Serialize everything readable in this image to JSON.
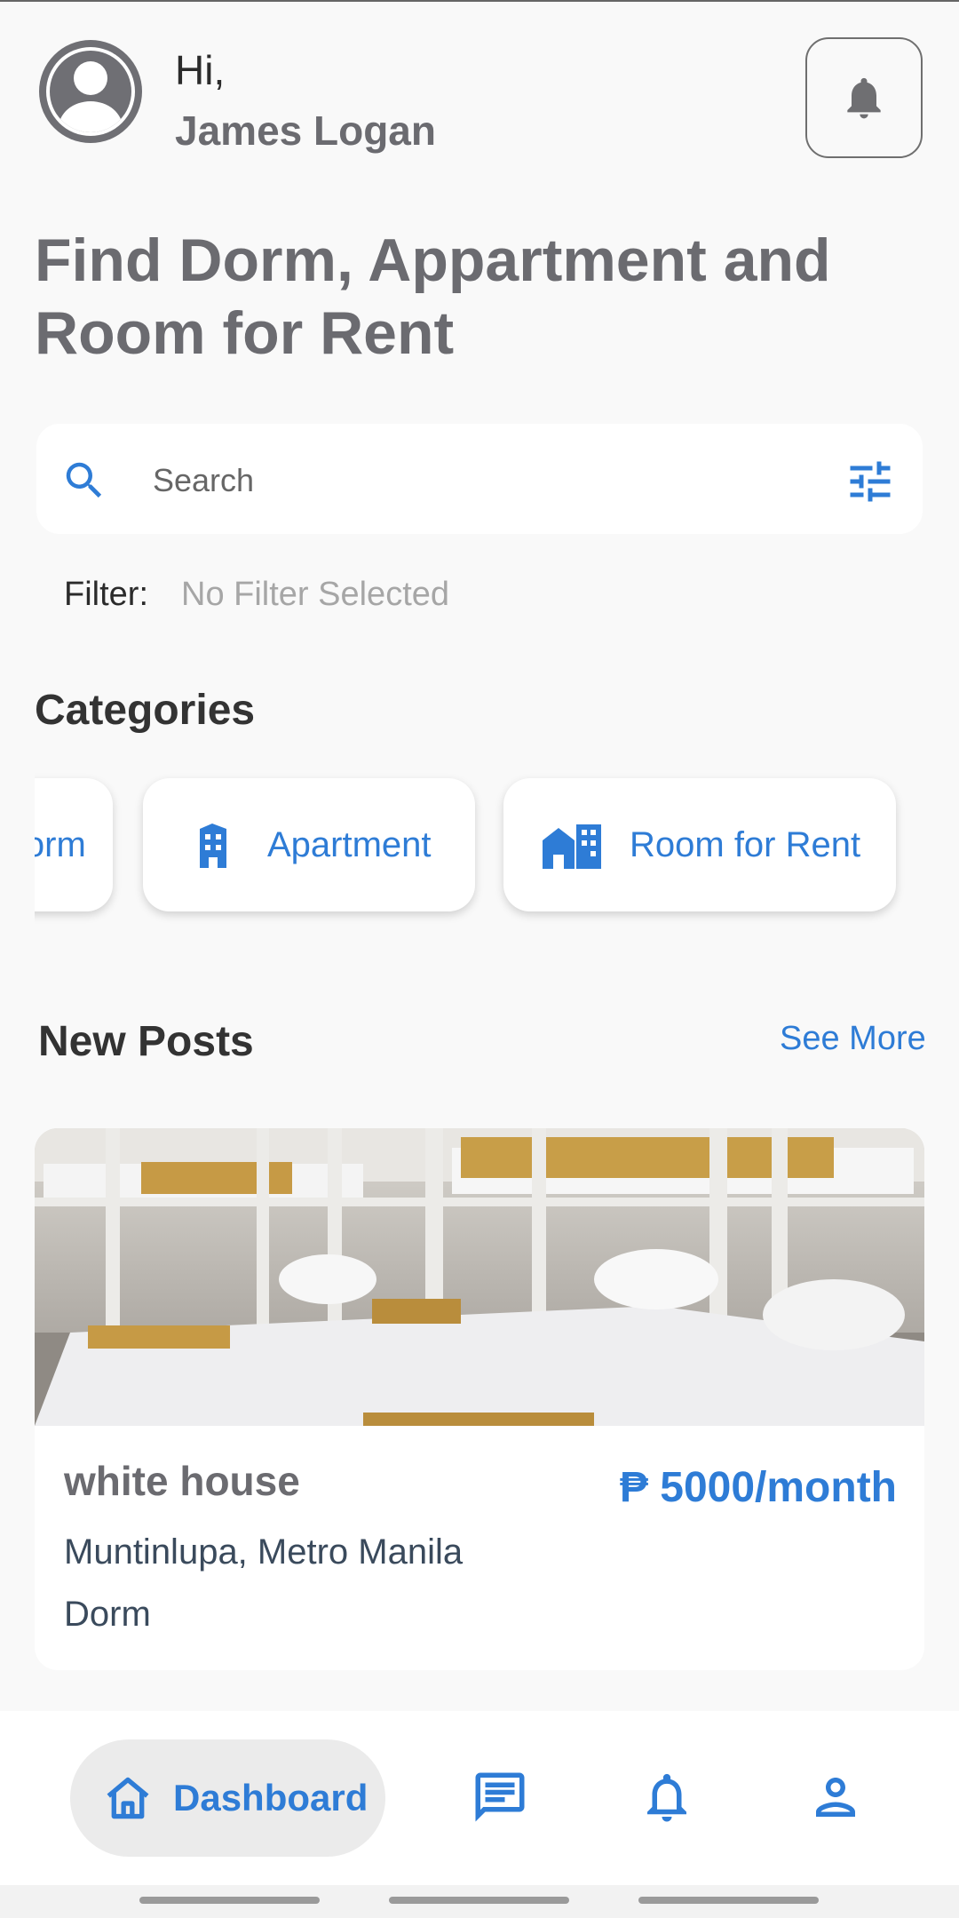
{
  "header": {
    "greeting": "Hi,",
    "user_name": "James Logan",
    "headline": "Find Dorm, Appartment and Room for Rent"
  },
  "search": {
    "placeholder": "Search",
    "value": ""
  },
  "filter": {
    "label": "Filter:",
    "value": "No Filter Selected"
  },
  "categories": {
    "title": "Categories",
    "items": [
      {
        "label": "Dorm",
        "icon": "dorm-icon"
      },
      {
        "label": "Apartment",
        "icon": "apartment-building-icon"
      },
      {
        "label": "Room for Rent",
        "icon": "house-building-icon"
      }
    ]
  },
  "new_posts": {
    "title": "New Posts",
    "see_more": "See More",
    "posts": [
      {
        "title": "white house",
        "price": "₱ 5000/month",
        "location": "Muntinlupa, Metro Manila",
        "type": "Dorm",
        "image": "bunk-beds-photo"
      }
    ]
  },
  "bottom_nav": {
    "items": [
      {
        "label": "Dashboard",
        "icon": "home-icon",
        "active": true
      },
      {
        "label": "",
        "icon": "chat-icon"
      },
      {
        "label": "",
        "icon": "bell-icon"
      },
      {
        "label": "",
        "icon": "person-icon"
      }
    ]
  },
  "colors": {
    "accent": "#2e7cd6",
    "heading_gray": "#6b6b70",
    "background": "#f9f9f9"
  }
}
